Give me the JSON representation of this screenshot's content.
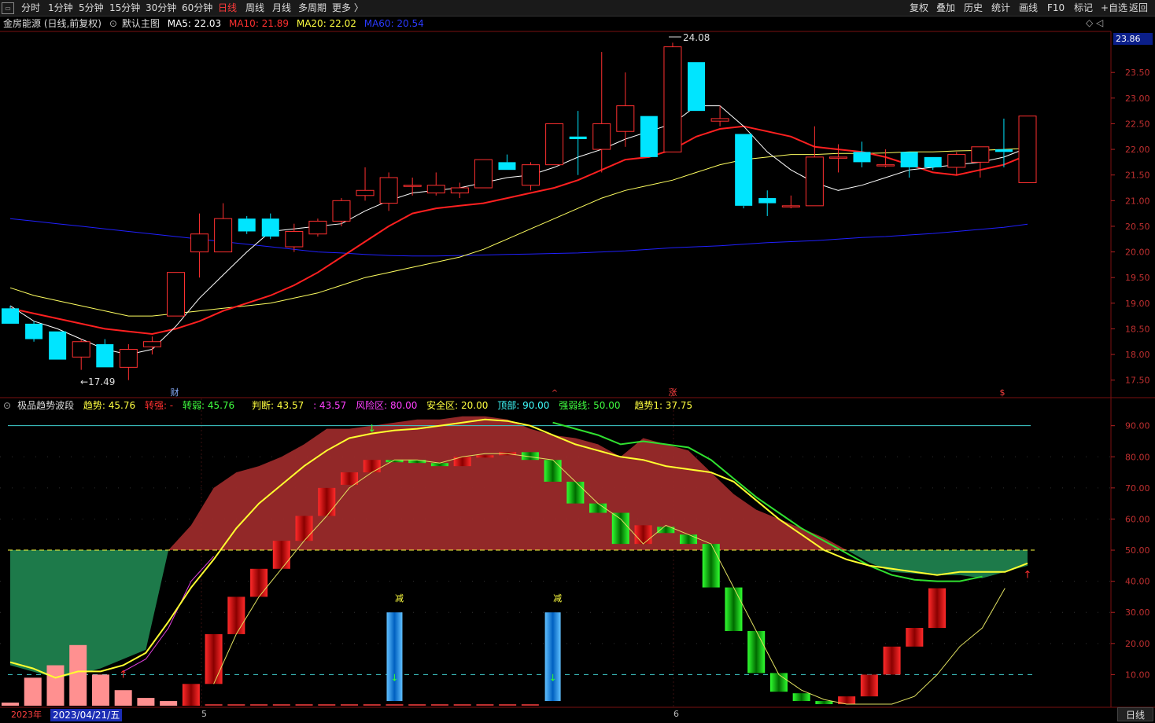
{
  "toolbar": {
    "left": [
      "分时",
      "1分钟",
      "5分钟",
      "15分钟",
      "30分钟",
      "60分钟",
      "日线",
      "周线",
      "月线",
      "多周期",
      "更多 〉"
    ],
    "active_index": 6,
    "right": [
      "复权",
      "叠加",
      "历史",
      "统计",
      "画线",
      "F10",
      "标记",
      "+自选",
      "返回"
    ]
  },
  "main_info": {
    "title": "金房能源 (日线,前复权)",
    "template": "默认主图",
    "ma5": "MA5: 22.03",
    "ma10": "MA10: 21.89",
    "ma20": "MA20: 22.02",
    "ma60": "MA60: 20.54"
  },
  "price_badge": "23.86",
  "high_label": "24.08",
  "low_label": "←17.49",
  "markers": {
    "cai": "财",
    "zhang": "涨",
    "s": "$",
    "a": "^",
    "jian": "减",
    "arrow_up": "↑",
    "arrow_down": "↓"
  },
  "indicator_info": {
    "name": "极品趋势波段",
    "qushi": "趋势: 45.76",
    "zhuanqiang": "转强: -",
    "zhuanruo": "转弱: 45.76",
    "panduan": "判断: 43.57",
    "v2": ": 43.57",
    "fengxian": "风险区: 80.00",
    "anquan": "安全区: 20.00",
    "dingbu": "顶部: 90.00",
    "qiangruo": "强弱线: 50.00",
    "qushi1": "趋势1: 37.75"
  },
  "bottom": {
    "year": "2023年",
    "date": "2023/04/21/五",
    "t5": "5",
    "t6": "6",
    "rixian": "日线"
  },
  "colors": {
    "up": "#ff3030",
    "down": "#00e5ff",
    "ma5": "#ffffff",
    "ma10": "#ff2020",
    "ma20": "#ffff60",
    "ma60": "#2020ff"
  },
  "chart_data": [
    {
      "type": "candlestick",
      "title": "金房能源 (日线,前复权)",
      "yticks": [
        17.5,
        18.0,
        18.5,
        19.0,
        19.5,
        20.0,
        20.5,
        21.0,
        21.5,
        22.0,
        22.5,
        23.0,
        23.5
      ],
      "ylim": [
        17.25,
        24.3
      ],
      "candles": [
        {
          "o": 18.9,
          "h": 18.95,
          "l": 18.6,
          "c": 18.6
        },
        {
          "o": 18.6,
          "h": 18.65,
          "l": 18.25,
          "c": 18.3
        },
        {
          "o": 18.45,
          "h": 18.45,
          "l": 17.9,
          "c": 17.9
        },
        {
          "o": 17.95,
          "h": 18.3,
          "l": 17.7,
          "c": 18.25
        },
        {
          "o": 18.2,
          "h": 18.3,
          "l": 17.75,
          "c": 17.75
        },
        {
          "o": 17.75,
          "h": 18.2,
          "l": 17.5,
          "c": 18.1
        },
        {
          "o": 18.15,
          "h": 18.35,
          "l": 18.0,
          "c": 18.25
        },
        {
          "o": 18.75,
          "h": 19.6,
          "l": 18.75,
          "c": 19.6
        },
        {
          "o": 20.0,
          "h": 20.75,
          "l": 19.5,
          "c": 20.35
        },
        {
          "o": 20.0,
          "h": 20.95,
          "l": 20.0,
          "c": 20.65
        },
        {
          "o": 20.65,
          "h": 20.7,
          "l": 20.35,
          "c": 20.4
        },
        {
          "o": 20.65,
          "h": 20.75,
          "l": 20.25,
          "c": 20.3
        },
        {
          "o": 20.1,
          "h": 20.55,
          "l": 20.0,
          "c": 20.4
        },
        {
          "o": 20.35,
          "h": 20.65,
          "l": 20.3,
          "c": 20.6
        },
        {
          "o": 20.6,
          "h": 21.05,
          "l": 20.5,
          "c": 21.0
        },
        {
          "o": 21.1,
          "h": 21.65,
          "l": 21.0,
          "c": 21.2
        },
        {
          "o": 20.95,
          "h": 21.55,
          "l": 20.8,
          "c": 21.45
        },
        {
          "o": 21.3,
          "h": 21.45,
          "l": 21.1,
          "c": 21.3
        },
        {
          "o": 21.15,
          "h": 21.55,
          "l": 21.1,
          "c": 21.3
        },
        {
          "o": 21.15,
          "h": 21.35,
          "l": 21.05,
          "c": 21.25
        },
        {
          "o": 21.25,
          "h": 21.8,
          "l": 21.25,
          "c": 21.8
        },
        {
          "o": 21.75,
          "h": 21.9,
          "l": 21.6,
          "c": 21.6
        },
        {
          "o": 21.3,
          "h": 21.75,
          "l": 21.2,
          "c": 21.7
        },
        {
          "o": 21.7,
          "h": 22.4,
          "l": 21.7,
          "c": 22.5
        },
        {
          "o": 22.25,
          "h": 22.75,
          "l": 21.5,
          "c": 22.2
        },
        {
          "o": 22.0,
          "h": 23.9,
          "l": 21.55,
          "c": 22.5
        },
        {
          "o": 22.35,
          "h": 23.5,
          "l": 22.05,
          "c": 22.85
        },
        {
          "o": 22.65,
          "h": 22.65,
          "l": 21.85,
          "c": 21.85
        },
        {
          "o": 21.95,
          "h": 24.08,
          "l": 21.95,
          "c": 24.0
        },
        {
          "o": 23.7,
          "h": 23.7,
          "l": 22.75,
          "c": 22.75
        },
        {
          "o": 22.55,
          "h": 22.85,
          "l": 22.45,
          "c": 22.6
        },
        {
          "o": 22.3,
          "h": 22.3,
          "l": 20.85,
          "c": 20.9
        },
        {
          "o": 21.05,
          "h": 21.2,
          "l": 20.7,
          "c": 20.95
        },
        {
          "o": 20.9,
          "h": 21.1,
          "l": 20.85,
          "c": 20.9
        },
        {
          "o": 20.9,
          "h": 22.45,
          "l": 20.9,
          "c": 21.85
        },
        {
          "o": 21.85,
          "h": 22.1,
          "l": 21.55,
          "c": 21.85
        },
        {
          "o": 21.95,
          "h": 22.15,
          "l": 21.65,
          "c": 21.75
        },
        {
          "o": 21.7,
          "h": 22.0,
          "l": 21.65,
          "c": 21.7
        },
        {
          "o": 21.95,
          "h": 21.95,
          "l": 21.45,
          "c": 21.65
        },
        {
          "o": 21.85,
          "h": 21.85,
          "l": 21.6,
          "c": 21.65
        },
        {
          "o": 21.65,
          "h": 21.95,
          "l": 21.5,
          "c": 21.9
        },
        {
          "o": 21.75,
          "h": 22.05,
          "l": 21.45,
          "c": 22.05
        },
        {
          "o": 22.0,
          "h": 22.6,
          "l": 21.65,
          "c": 21.95
        },
        {
          "o": 21.35,
          "h": 22.65,
          "l": 21.35,
          "c": 22.65
        }
      ],
      "ma5": [
        18.95,
        18.65,
        18.5,
        18.3,
        18.1,
        18.0,
        18.1,
        18.55,
        19.1,
        19.55,
        20.0,
        20.4,
        20.45,
        20.5,
        20.55,
        20.8,
        21.0,
        21.15,
        21.2,
        21.25,
        21.35,
        21.45,
        21.5,
        21.65,
        21.85,
        22.0,
        22.2,
        22.35,
        22.5,
        22.85,
        22.85,
        22.45,
        21.95,
        21.6,
        21.35,
        21.2,
        21.3,
        21.45,
        21.6,
        21.65,
        21.7,
        21.75,
        21.85,
        22.03
      ],
      "ma10": [
        18.9,
        18.8,
        18.7,
        18.6,
        18.5,
        18.45,
        18.4,
        18.5,
        18.65,
        18.85,
        19.0,
        19.15,
        19.35,
        19.6,
        19.9,
        20.2,
        20.5,
        20.75,
        20.85,
        20.9,
        20.95,
        21.05,
        21.15,
        21.25,
        21.4,
        21.6,
        21.8,
        21.85,
        22.0,
        22.25,
        22.4,
        22.45,
        22.35,
        22.25,
        22.05,
        22.0,
        21.95,
        21.85,
        21.7,
        21.55,
        21.5,
        21.6,
        21.7,
        21.89
      ],
      "ma20": [
        19.3,
        19.15,
        19.05,
        18.95,
        18.85,
        18.75,
        18.75,
        18.8,
        18.85,
        18.9,
        18.95,
        19.0,
        19.1,
        19.2,
        19.35,
        19.5,
        19.6,
        19.7,
        19.8,
        19.9,
        20.05,
        20.25,
        20.45,
        20.65,
        20.85,
        21.05,
        21.2,
        21.3,
        21.4,
        21.55,
        21.7,
        21.8,
        21.85,
        21.9,
        21.9,
        21.92,
        21.92,
        21.93,
        21.95,
        21.95,
        21.97,
        21.98,
        22.0,
        22.02
      ],
      "ma60": [
        20.65,
        20.6,
        20.55,
        20.5,
        20.45,
        20.4,
        20.35,
        20.3,
        20.25,
        20.2,
        20.15,
        20.1,
        20.05,
        20.0,
        19.98,
        19.95,
        19.93,
        19.92,
        19.92,
        19.93,
        19.94,
        19.95,
        19.96,
        19.97,
        19.98,
        20.0,
        20.02,
        20.05,
        20.08,
        20.1,
        20.12,
        20.15,
        20.18,
        20.2,
        20.22,
        20.25,
        20.28,
        20.3,
        20.33,
        20.36,
        20.4,
        20.44,
        20.48,
        20.54
      ]
    },
    {
      "type": "bar",
      "title": "极品趋势波段",
      "yticks": [
        10,
        20,
        30,
        40,
        50,
        60,
        70,
        80,
        90
      ],
      "ylim": [
        0,
        98
      ],
      "levels": {
        "dingbu": 90,
        "fengxian": 80,
        "qiangruo": 50,
        "anquan": 20,
        "low": 10
      },
      "bars_open": [
        0.5,
        9,
        13,
        19,
        10,
        5,
        2,
        1,
        7,
        23,
        35,
        44,
        53,
        61,
        70,
        75,
        79,
        79,
        79,
        78,
        80,
        81,
        81,
        80,
        79,
        72,
        65,
        62,
        52,
        58,
        56,
        55,
        52,
        38,
        24,
        11,
        6,
        3,
        1,
        0.3,
        0.3,
        3,
        10,
        19,
        25,
        37
      ],
      "bars_close": [
        1,
        1,
        1,
        1,
        1,
        1,
        1,
        1,
        1,
        1,
        1,
        1,
        1,
        1,
        1,
        1,
        1,
        1,
        1,
        1,
        1,
        1,
        1,
        1,
        1,
        1,
        1,
        1,
        1,
        1,
        1,
        1,
        1,
        1,
        1,
        1,
        1,
        1,
        1,
        1,
        1,
        1,
        1,
        1,
        1,
        1
      ],
      "candle_bars": [
        {
          "o": 0,
          "c": 7,
          "t": "up"
        },
        {
          "o": 7,
          "c": 23,
          "t": "up"
        },
        {
          "o": 23,
          "c": 35,
          "t": "up"
        },
        {
          "o": 35,
          "c": 44,
          "t": "up"
        },
        {
          "o": 44,
          "c": 53,
          "t": "up"
        },
        {
          "o": 53,
          "c": 61,
          "t": "up"
        },
        {
          "o": 61,
          "c": 70,
          "t": "up"
        },
        {
          "o": 71,
          "c": 75,
          "t": "up"
        },
        {
          "o": 75,
          "c": 79,
          "t": "up"
        },
        {
          "o": 79,
          "c": 78.5,
          "t": "dn"
        },
        {
          "o": 79,
          "c": 78,
          "t": "dn"
        },
        {
          "o": 78,
          "c": 77,
          "t": "dn"
        },
        {
          "o": 77,
          "c": 80,
          "t": "up"
        },
        {
          "o": 80,
          "c": 80.5,
          "t": "up"
        },
        {
          "o": 80.5,
          "c": 81.5,
          "t": "up"
        },
        {
          "o": 81.5,
          "c": 79,
          "t": "dn"
        },
        {
          "o": 79,
          "c": 72,
          "t": "dn"
        },
        {
          "o": 72,
          "c": 65,
          "t": "dn"
        },
        {
          "o": 65,
          "c": 62,
          "t": "dn"
        },
        {
          "o": 62,
          "c": 52,
          "t": "dn"
        },
        {
          "o": 52,
          "c": 58,
          "t": "up"
        },
        {
          "o": 57.5,
          "c": 55.5,
          "t": "dn"
        },
        {
          "o": 55,
          "c": 52,
          "t": "dn"
        },
        {
          "o": 52,
          "c": 38,
          "t": "dn"
        },
        {
          "o": 38,
          "c": 24,
          "t": "dn"
        },
        {
          "o": 24,
          "c": 10.5,
          "t": "dn"
        },
        {
          "o": 10.5,
          "c": 4.5,
          "t": "dn"
        },
        {
          "o": 4,
          "c": 1.5,
          "t": "dn"
        },
        {
          "o": 1.5,
          "c": 0.5,
          "t": "dn"
        },
        {
          "o": 0.5,
          "c": 3,
          "t": "up"
        },
        {
          "o": 3,
          "c": 10,
          "t": "up"
        },
        {
          "o": 10,
          "c": 19,
          "t": "up"
        },
        {
          "o": 19,
          "c": 25,
          "t": "up"
        },
        {
          "o": 25,
          "c": 37.75,
          "t": "up"
        }
      ],
      "pink_bars": [
        1,
        9,
        13,
        19.5,
        10,
        5,
        2.5,
        1.5
      ],
      "blue_bars": [
        {
          "x_idx": 17,
          "v": 30
        },
        {
          "x_idx": 24,
          "v": 30
        }
      ],
      "trend_line": [
        14,
        12,
        9,
        11,
        11,
        13,
        17,
        27,
        38,
        47,
        57,
        65,
        71,
        77,
        82,
        86,
        87.5,
        88.5,
        89,
        90,
        91,
        92,
        91.5,
        90,
        87,
        84,
        82,
        80,
        79,
        77,
        76,
        75,
        72,
        66,
        60,
        55,
        50,
        47,
        45,
        44,
        43,
        42,
        43,
        43,
        43,
        45.76
      ],
      "white_line": [
        null,
        null,
        null,
        null,
        null,
        null,
        null,
        null,
        null,
        7,
        23,
        35,
        44,
        53,
        61,
        70,
        75,
        79,
        79,
        78,
        80,
        81,
        81,
        80,
        79,
        72,
        65,
        60,
        52,
        58,
        55,
        52,
        38,
        24,
        10,
        5,
        2,
        0.5,
        0.5,
        0.5,
        3,
        10,
        19,
        25,
        37.75
      ],
      "green_line": [
        null,
        null,
        null,
        null,
        null,
        null,
        null,
        null,
        null,
        null,
        null,
        null,
        null,
        null,
        null,
        null,
        null,
        null,
        null,
        null,
        null,
        null,
        null,
        null,
        91,
        89,
        87,
        84,
        85,
        84,
        83,
        79,
        73,
        67,
        62,
        57,
        53,
        49,
        45,
        42,
        40.5,
        40,
        40,
        41.5
      ]
    }
  ]
}
